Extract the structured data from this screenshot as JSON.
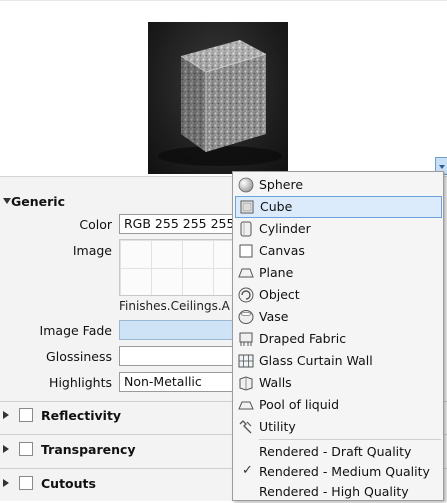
{
  "preview": {
    "thumbnail": "cube-preview-image",
    "dropdown": "chevron-down-icon"
  },
  "generic": {
    "title": "Generic",
    "color_label": "Color",
    "color_value": "RGB 255 255 255",
    "image_label": "Image",
    "image_filename": "Finishes.Ceilings.A",
    "image_fade_label": "Image Fade",
    "image_fade_value": "",
    "glossiness_label": "Glossiness",
    "glossiness_value": "",
    "highlights_label": "Highlights",
    "highlights_value": "Non-Metallic"
  },
  "sections": [
    {
      "label": "Reflectivity",
      "checked": false
    },
    {
      "label": "Transparency",
      "checked": false
    },
    {
      "label": "Cutouts",
      "checked": false
    }
  ],
  "menu": {
    "shapes": [
      {
        "label": "Sphere",
        "icon": "sphere-icon",
        "selected": false
      },
      {
        "label": "Cube",
        "icon": "cube-icon",
        "selected": true
      },
      {
        "label": "Cylinder",
        "icon": "cylinder-icon",
        "selected": false
      },
      {
        "label": "Canvas",
        "icon": "canvas-icon",
        "selected": false
      },
      {
        "label": "Plane",
        "icon": "plane-icon",
        "selected": false
      },
      {
        "label": "Object",
        "icon": "object-icon",
        "selected": false
      },
      {
        "label": "Vase",
        "icon": "vase-icon",
        "selected": false
      },
      {
        "label": "Draped Fabric",
        "icon": "draped-fabric-icon",
        "selected": false
      },
      {
        "label": "Glass Curtain Wall",
        "icon": "glass-curtain-wall-icon",
        "selected": false
      },
      {
        "label": "Walls",
        "icon": "walls-icon",
        "selected": false
      },
      {
        "label": "Pool of liquid",
        "icon": "pool-of-liquid-icon",
        "selected": false
      },
      {
        "label": "Utility",
        "icon": "utility-icon",
        "selected": false
      }
    ],
    "quality": [
      {
        "label": "Rendered - Draft Quality",
        "checked": false
      },
      {
        "label": "Rendered - Medium Quality",
        "checked": true,
        "check_glyph": "✓"
      },
      {
        "label": "Rendered - High Quality",
        "checked": false
      }
    ]
  },
  "colors": {
    "selection_fill": "#dcebfb",
    "selection_border": "#6aa3da",
    "panel_bg": "#f3f3f3",
    "image_fade_fill": "#cfe3f7"
  }
}
